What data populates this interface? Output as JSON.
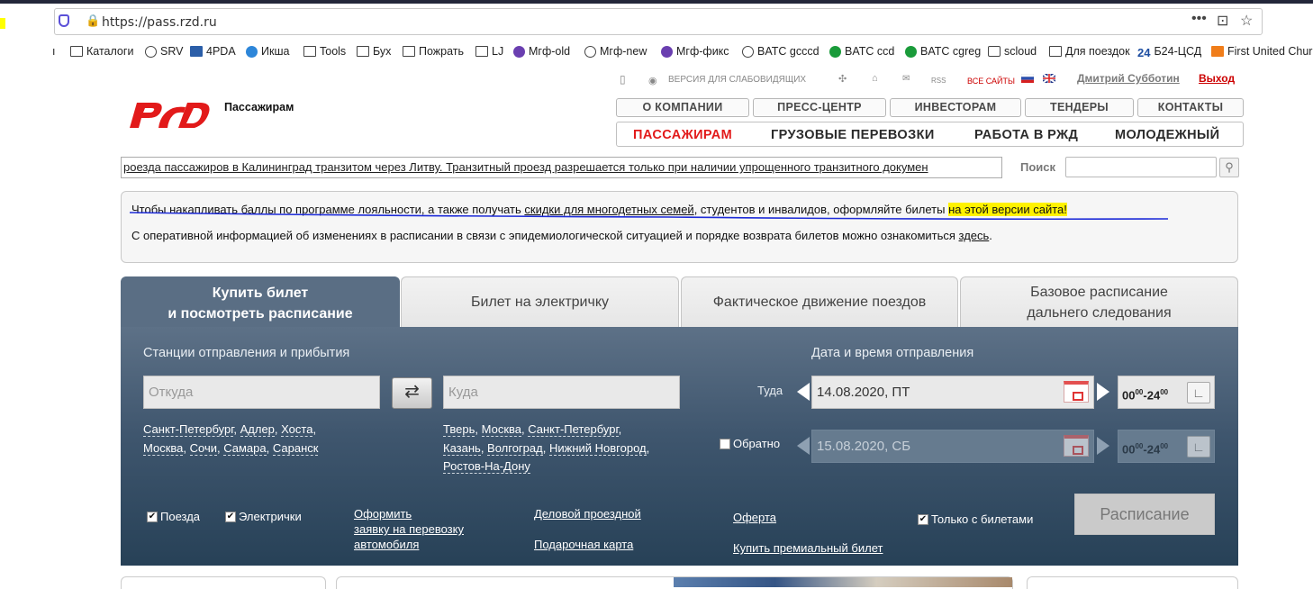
{
  "browser": {
    "url": "https://pass.rzd.ru",
    "bookmarks": [
      "Каталоги",
      "SRV",
      "4PDA",
      "Икша",
      "Tools",
      "Бух",
      "Пожрать",
      "LJ",
      "Мгф-old",
      "Мгф-new",
      "Мгф-фикс",
      "BATC gcccd",
      "BATC ccd",
      "BATC cgreg",
      "scloud",
      "Для поездок",
      "Б24-ЦСД",
      "First United Church"
    ],
    "bookmark_prefix": "24"
  },
  "header": {
    "brand": "Пассажирам",
    "accessibility": "ВЕРСИЯ ДЛЯ СЛАБОВИДЯЩИХ",
    "rss": "RSS",
    "all_sites": "ВСЕ САЙТЫ",
    "user": "Дмитрий Субботин",
    "logout": "Выход",
    "top_menu": [
      "О КОМПАНИИ",
      "ПРЕСС-ЦЕНТР",
      "ИНВЕСТОРАМ",
      "ТЕНДЕРЫ",
      "КОНТАКТЫ"
    ],
    "main_menu": [
      "ПАССАЖИРАМ",
      "ГРУЗОВЫЕ ПЕРЕВОЗКИ",
      "РАБОТА В РЖД",
      "МОЛОДЕЖНЫЙ"
    ]
  },
  "ticker": "роезда пассажиров в Калининград транзитом через Литву. Транзитный проезд разрешается только при наличии упрощенного транзитного докумен",
  "search": {
    "label": "Поиск",
    "placeholder": ""
  },
  "notice": {
    "l1_a": "Чтобы накапливать баллы по программе лояльности, а также получать ",
    "l1_link": "скидки для многодетных семей",
    "l1_b": ", студентов и инвалидов, оформляйте билеты ",
    "l1_hl": "на этой версии сайта!",
    "l2_a": "С оперативной информацией об изменениях в расписании в связи с эпидемиологической ситуацией и порядке возврата билетов можно ознакомиться ",
    "l2_link": "здесь",
    "l2_b": "."
  },
  "tabs": {
    "t1_l1": "Купить билет",
    "t1_l2": "и посмотреть расписание",
    "t2": "Билет на электричку",
    "t3": "Фактическое движение поездов",
    "t4_l1": "Базовое расписание",
    "t4_l2": "дальнего следования"
  },
  "form": {
    "stations_label": "Станции отправления и прибытия",
    "date_label": "Дата и время отправления",
    "from_placeholder": "Откуда",
    "to_placeholder": "Куда",
    "from_cities_l1": [
      "Санкт-Петербург",
      "Адлер",
      "Хоста"
    ],
    "from_cities_l2": [
      "Москва",
      "Сочи",
      "Самара",
      "Саранск"
    ],
    "to_cities_l1": [
      "Тверь",
      "Москва",
      "Санкт-Петербург"
    ],
    "to_cities_l2": [
      "Казань",
      "Волгоград",
      "Нижний Новгород"
    ],
    "to_cities_l3": [
      "Ростов-На-Дону"
    ],
    "there_label": "Туда",
    "there_date": "14.08.2020, ПТ",
    "back_label": "Обратно",
    "back_date": "15.08.2020, СБ",
    "time_from": "00",
    "time_from_sup": "00",
    "time_sep": "-",
    "time_to": "24",
    "time_to_sup": "00",
    "trains": "Поезда",
    "suburban": "Электрички",
    "car_link_l1": "Оформить",
    "car_link_l2": "заявку на перевозку",
    "car_link_l3": "автомобиля",
    "business": "Деловой проездной",
    "gift": "Подарочная карта",
    "offer": "Оферта",
    "premium": "Купить премиальный билет",
    "only_tickets": "Только с билетами",
    "schedule_btn": "Расписание"
  },
  "colors": {
    "brand_red": "#e21a1a",
    "panel": "#3f566e",
    "highlight": "#fff200"
  }
}
